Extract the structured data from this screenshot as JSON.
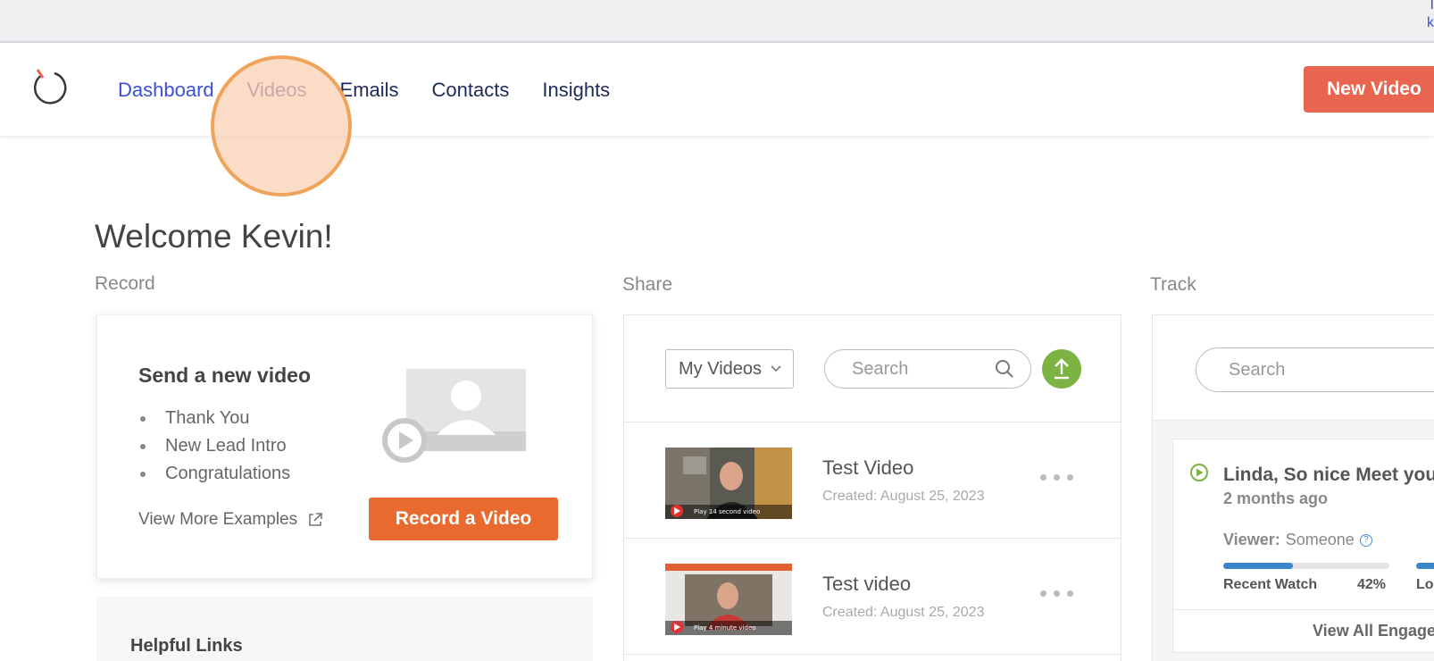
{
  "browser": {
    "edge_text_1": "I",
    "edge_text_2": "k"
  },
  "nav": {
    "links": [
      "Dashboard",
      "Videos",
      "Emails",
      "Contacts",
      "Insights"
    ],
    "new_video_label": "New Video"
  },
  "welcome": "Welcome Kevin!",
  "sections": {
    "record": "Record",
    "share": "Share",
    "track": "Track"
  },
  "record_card": {
    "title": "Send a new video",
    "examples": [
      "Thank You",
      "New Lead Intro",
      "Congratulations"
    ],
    "view_more": "View More Examples",
    "record_button": "Record a Video"
  },
  "helpful": {
    "title": "Helpful Links"
  },
  "share": {
    "filter_selected": "My Videos",
    "search_placeholder": "Search",
    "videos": [
      {
        "title": "Test Video",
        "date": "Created: August 25, 2023",
        "thumb_caption": "Play 14 second video"
      },
      {
        "title": "Test video",
        "date": "Created: August 25, 2023",
        "thumb_caption": "Play 4 minute video"
      }
    ]
  },
  "track": {
    "search_placeholder": "Search",
    "engagement": {
      "title": "Linda, So nice Meet you",
      "time": "2 months ago",
      "viewer_label": "Viewer:",
      "viewer_value": "Someone",
      "recent_label": "Recent Watch",
      "percent": "42%",
      "percent_value": 0.42,
      "second_label": "Lo",
      "view_all": "View All Engage"
    }
  },
  "colors": {
    "accent": "#e86550",
    "record": "#e96a2e",
    "upload": "#7cb342",
    "link": "#3b4fd6",
    "progress": "#3a86c8"
  }
}
